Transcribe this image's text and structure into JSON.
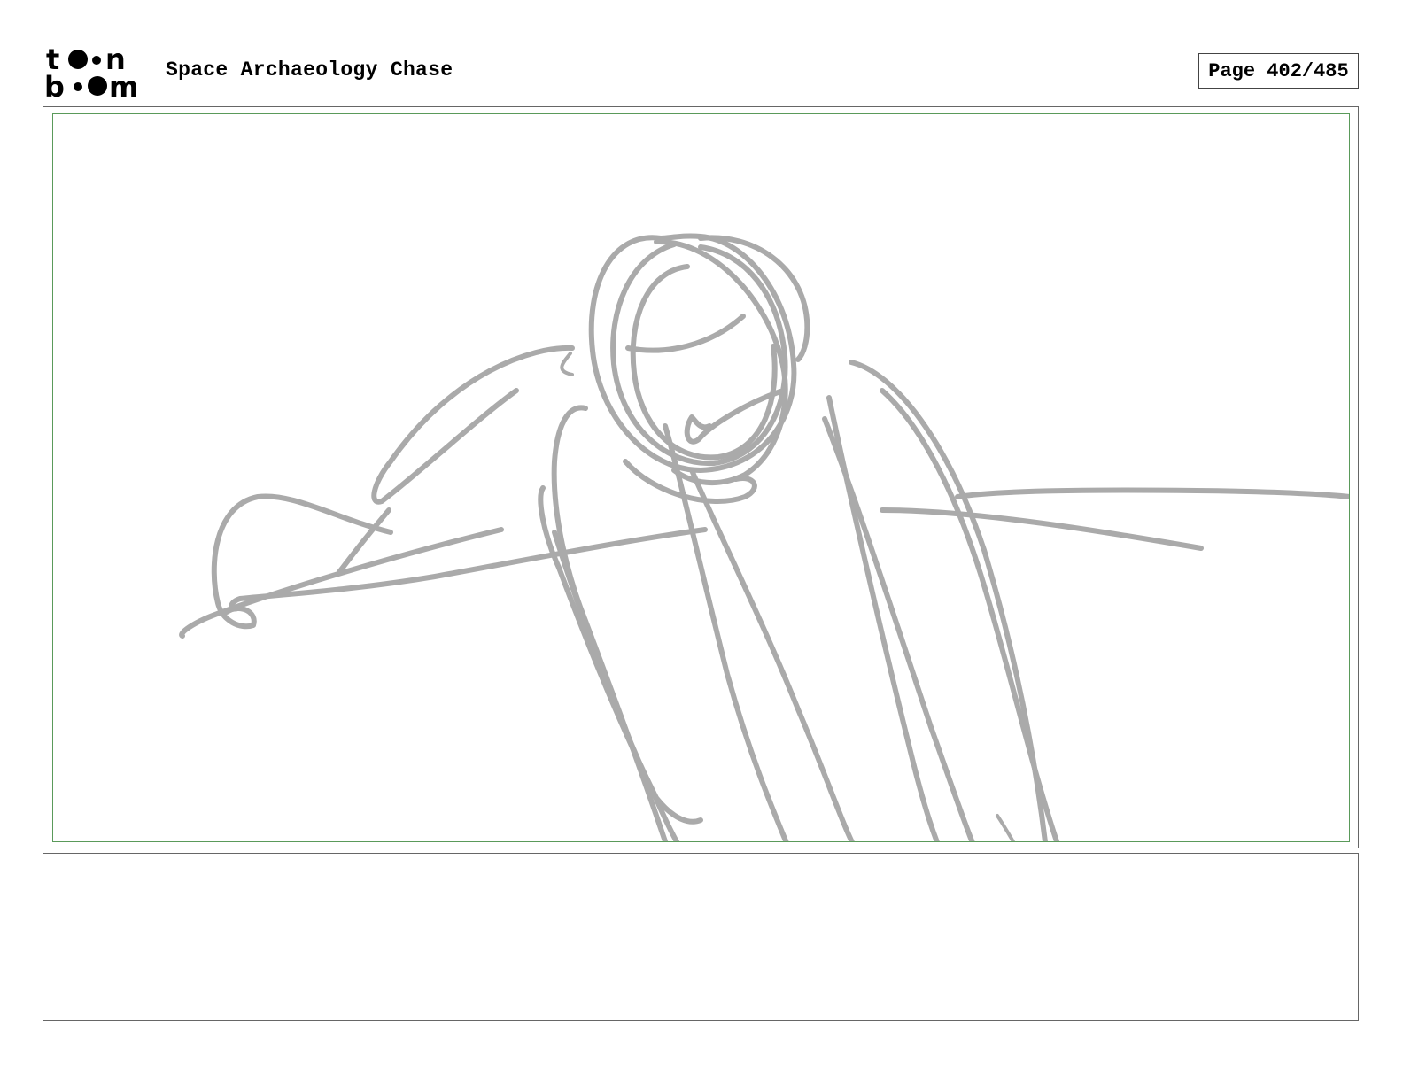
{
  "header": {
    "logo_text": "toon boom",
    "project_title": "Space Archaeology Chase",
    "page_label": "Page 402/485"
  },
  "panel": {
    "sketch_stroke_color": "#aaaaaa",
    "safe_area_color": "#5a9a5a"
  },
  "caption": {
    "text": ""
  }
}
